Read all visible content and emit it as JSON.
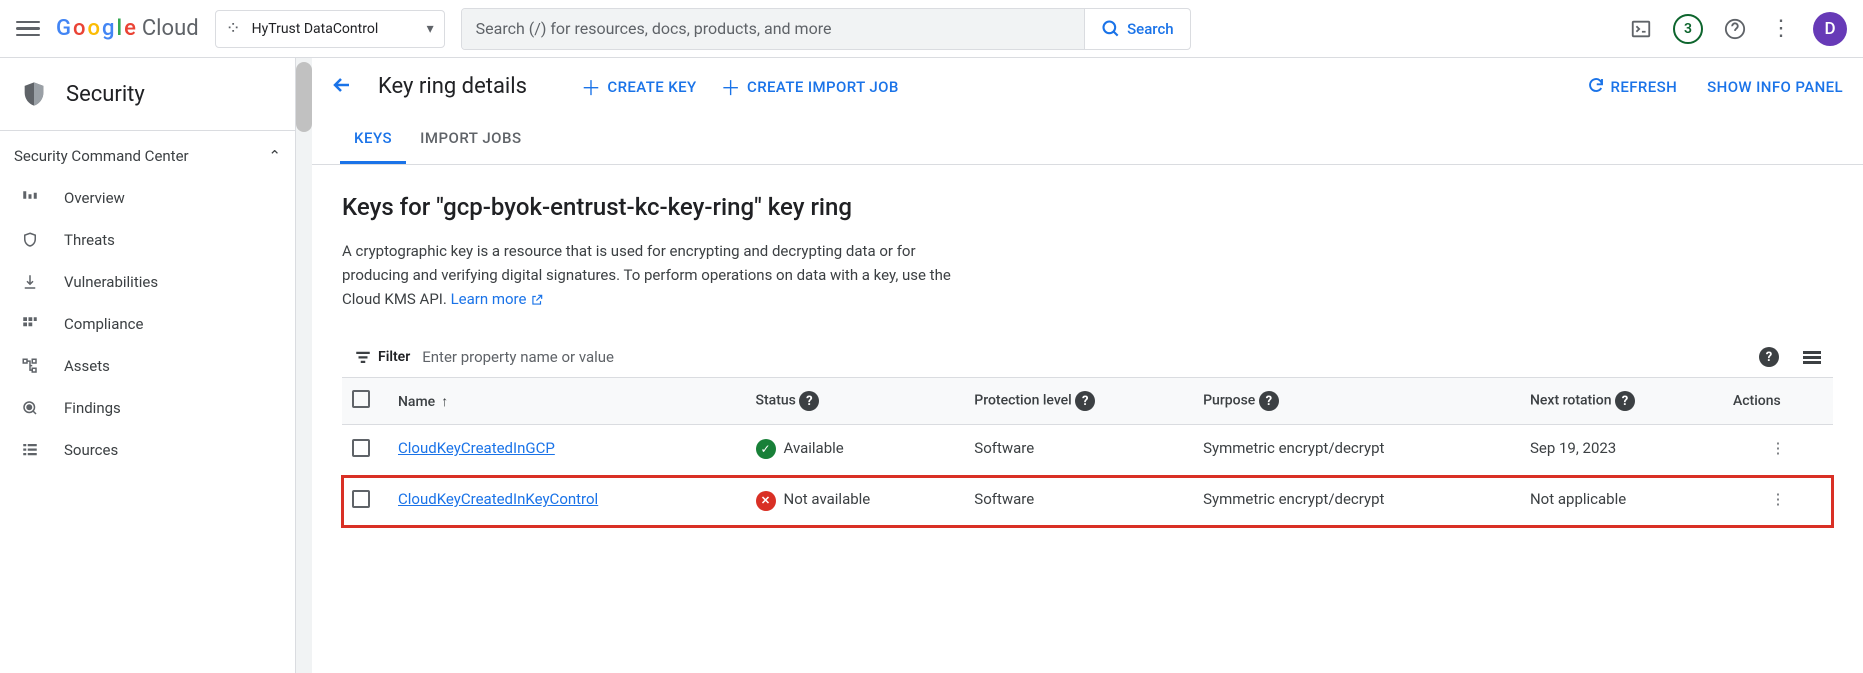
{
  "topbar": {
    "project_name": "HyTrust DataControl",
    "search_placeholder": "Search (/) for resources, docs, products, and more",
    "search_button": "Search",
    "trial_count": "3",
    "avatar_initial": "D"
  },
  "sidebar": {
    "product": "Security",
    "section": "Security Command Center",
    "items": [
      {
        "label": "Overview"
      },
      {
        "label": "Threats"
      },
      {
        "label": "Vulnerabilities"
      },
      {
        "label": "Compliance"
      },
      {
        "label": "Assets"
      },
      {
        "label": "Findings"
      },
      {
        "label": "Sources"
      }
    ]
  },
  "action_bar": {
    "title": "Key ring details",
    "create_key": "CREATE KEY",
    "create_import": "CREATE IMPORT JOB",
    "refresh": "REFRESH",
    "info_panel": "SHOW INFO PANEL"
  },
  "tabs": {
    "keys": "KEYS",
    "import": "IMPORT JOBS"
  },
  "content": {
    "heading": "Keys for \"gcp-byok-entrust-kc-key-ring\" key ring",
    "description": "A cryptographic key is a resource that is used for encrypting and decrypting data or for producing and verifying digital signatures. To perform operations on data with a key, use the Cloud KMS API. ",
    "learn_more": "Learn more",
    "filter_label": "Filter",
    "filter_placeholder": "Enter property name or value"
  },
  "table": {
    "columns": {
      "name": "Name",
      "status": "Status",
      "protection": "Protection level",
      "purpose": "Purpose",
      "rotation": "Next rotation",
      "actions": "Actions"
    },
    "rows": [
      {
        "name": "CloudKeyCreatedInGCP",
        "status_text": "Available",
        "status_ok": true,
        "protection": "Software",
        "purpose": "Symmetric encrypt/decrypt",
        "rotation": "Sep 19, 2023",
        "highlight": false
      },
      {
        "name": "CloudKeyCreatedInKeyControl",
        "status_text": "Not available",
        "status_ok": false,
        "protection": "Software",
        "purpose": "Symmetric encrypt/decrypt",
        "rotation": "Not applicable",
        "highlight": true
      }
    ]
  }
}
